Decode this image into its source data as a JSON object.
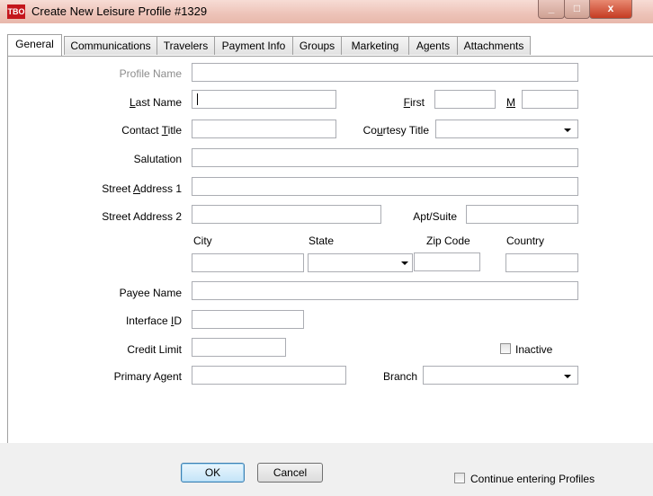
{
  "window": {
    "title": "Create New Leisure Profile #1329",
    "icon_text": "TBO",
    "buttons": {
      "minimize": "_",
      "maximize": "□",
      "close": "x"
    }
  },
  "tabs": [
    {
      "label": "General",
      "active": true
    },
    {
      "label": "Communications",
      "active": false
    },
    {
      "label": "Travelers",
      "active": false
    },
    {
      "label": "Payment Info",
      "active": false
    },
    {
      "label": "Groups",
      "active": false
    },
    {
      "label": "Marketing",
      "active": false
    },
    {
      "label": "Agents",
      "active": false
    },
    {
      "label": "Attachments",
      "active": false
    }
  ],
  "form": {
    "profile_name_label": "Profile Name",
    "last_name_label_u": "L",
    "last_name_label_rest": "ast Name",
    "first_label_u": "F",
    "first_label_rest": "irst",
    "m_label": "M",
    "contact_title_label_pre": "Contact ",
    "contact_title_label_u": "T",
    "contact_title_label_rest": "itle",
    "courtesy_title_label_pre": "Co",
    "courtesy_title_label_u": "u",
    "courtesy_title_label_rest": "rtesy Title",
    "salutation_label": "Salutation",
    "street1_label_pre": "Street ",
    "street1_label_u": "A",
    "street1_label_rest": "ddress 1",
    "street2_label": "Street Address 2",
    "apt_label": "Apt/Suite",
    "city_label": "City",
    "state_label": "State",
    "zip_label": "Zip Code",
    "country_label": "Country",
    "payee_label": "Payee Name",
    "interface_label_pre": "Interface ",
    "interface_label_u": "I",
    "interface_label_rest": "D",
    "credit_label": "Credit Limit",
    "inactive_label": "Inactive",
    "primary_agent_label": "Primary Agent",
    "branch_label": "Branch",
    "values": {
      "profile_name": "",
      "last_name": "",
      "first": "",
      "m": "",
      "contact_title": "",
      "courtesy_title": "",
      "salutation": "",
      "street1": "",
      "street2": "",
      "apt": "",
      "city": "",
      "state": "",
      "zip": "",
      "country": "",
      "payee": "",
      "interface_id": "",
      "credit_limit": "",
      "primary_agent": "",
      "branch": ""
    },
    "inactive_checked": false
  },
  "footer": {
    "ok_label": "OK",
    "cancel_label": "Cancel",
    "continue_label": "Continue entering Profiles",
    "continue_checked": false
  }
}
